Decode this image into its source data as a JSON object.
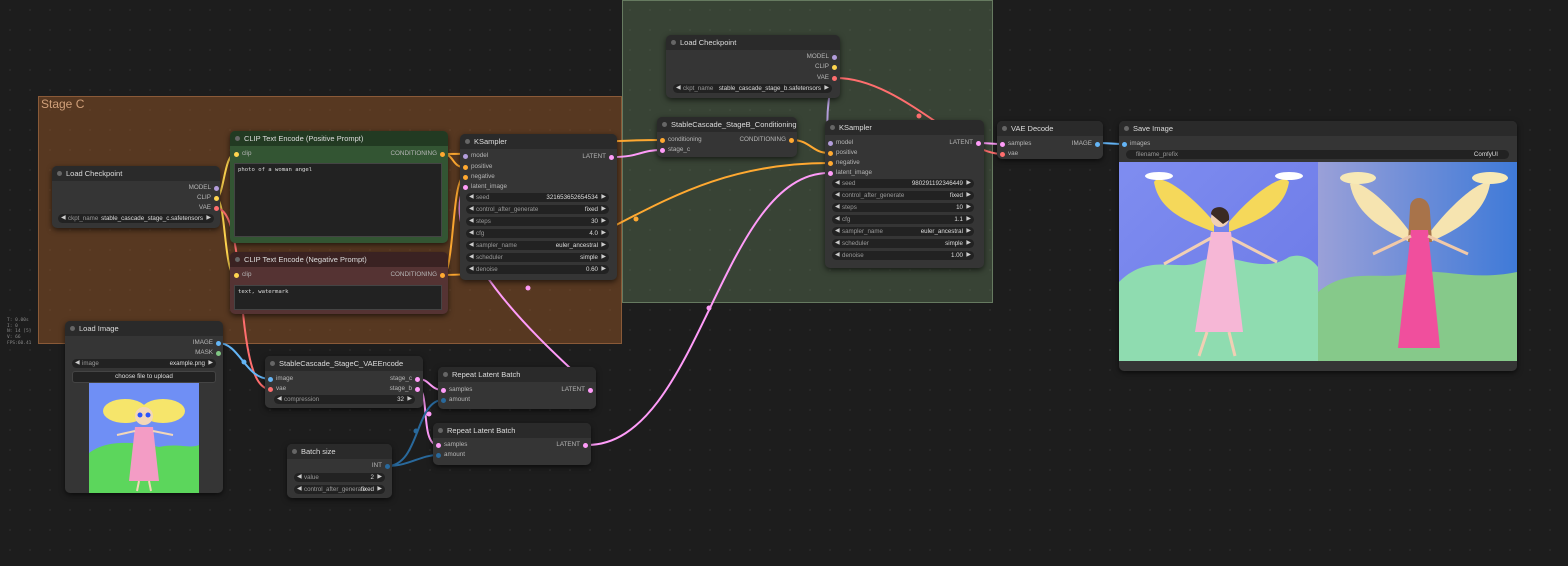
{
  "groups": {
    "stage_c": {
      "title": "Stage C"
    }
  },
  "stats": [
    "T: 0.00s",
    "I: 0",
    "N: 14 [5]",
    "V: 66",
    "FPS:60.41"
  ],
  "nodes": {
    "load_ckpt_c": {
      "title": "Load Checkpoint",
      "out_model": "MODEL",
      "out_clip": "CLIP",
      "out_vae": "VAE",
      "ckpt_label": "ckpt_name",
      "ckpt_value": "stable_cascade_stage_c.safetensors"
    },
    "clip_pos": {
      "title": "CLIP Text Encode (Positive Prompt)",
      "in_clip": "clip",
      "out": "CONDITIONING",
      "text": "photo of a woman angel"
    },
    "clip_neg": {
      "title": "CLIP Text Encode (Negative Prompt)",
      "in_clip": "clip",
      "out": "CONDITIONING",
      "text": "text, watermark"
    },
    "ksampler_c": {
      "title": "KSampler",
      "in_model": "model",
      "in_positive": "positive",
      "in_negative": "negative",
      "in_latent": "latent_image",
      "out": "LATENT",
      "w": [
        {
          "label": "seed",
          "value": "321653652654534"
        },
        {
          "label": "control_after_generate",
          "value": "fixed"
        },
        {
          "label": "steps",
          "value": "30"
        },
        {
          "label": "cfg",
          "value": "4.0"
        },
        {
          "label": "sampler_name",
          "value": "euler_ancestral"
        },
        {
          "label": "scheduler",
          "value": "simple"
        },
        {
          "label": "denoise",
          "value": "0.60"
        }
      ]
    },
    "load_image": {
      "title": "Load Image",
      "out_image": "IMAGE",
      "out_mask": "MASK",
      "image_label": "image",
      "image_value": "example.png",
      "upload": "choose file to upload"
    },
    "vae_encode": {
      "title": "StableCascade_StageC_VAEEncode",
      "in_image": "image",
      "in_vae": "vae",
      "out_c": "stage_c",
      "out_b": "stage_b",
      "comp_label": "compression",
      "comp_value": "32"
    },
    "repeat1": {
      "title": "Repeat Latent Batch",
      "in_samples": "samples",
      "in_amount": "amount",
      "out": "LATENT"
    },
    "repeat2": {
      "title": "Repeat Latent Batch",
      "in_samples": "samples",
      "in_amount": "amount",
      "out": "LATENT"
    },
    "batch": {
      "title": "Batch size",
      "out": "INT",
      "value_label": "value",
      "value_value": "2",
      "ctrl_label": "control_after_generate",
      "ctrl_value": "fixed"
    },
    "load_ckpt_b": {
      "title": "Load Checkpoint",
      "out_model": "MODEL",
      "out_clip": "CLIP",
      "out_vae": "VAE",
      "ckpt_label": "ckpt_name",
      "ckpt_value": "stable_cascade_stage_b.safetensors"
    },
    "stageb_cond": {
      "title": "StableCascade_StageB_Conditioning",
      "in_cond": "conditioning",
      "in_stagec": "stage_c",
      "out": "CONDITIONING"
    },
    "ksampler_b": {
      "title": "KSampler",
      "in_model": "model",
      "in_positive": "positive",
      "in_negative": "negative",
      "in_latent": "latent_image",
      "out": "LATENT",
      "w": [
        {
          "label": "seed",
          "value": "980291192346449"
        },
        {
          "label": "control_after_generate",
          "value": "fixed"
        },
        {
          "label": "steps",
          "value": "10"
        },
        {
          "label": "cfg",
          "value": "1.1"
        },
        {
          "label": "sampler_name",
          "value": "euler_ancestral"
        },
        {
          "label": "scheduler",
          "value": "simple"
        },
        {
          "label": "denoise",
          "value": "1.00"
        }
      ]
    },
    "vae_decode": {
      "title": "VAE Decode",
      "in_samples": "samples",
      "in_vae": "vae",
      "out": "IMAGE"
    },
    "save_image": {
      "title": "Save Image",
      "in_images": "images",
      "prefix_label": "filename_prefix",
      "prefix_value": "ComfyUI"
    }
  },
  "colors": {
    "model": "#b39ddb",
    "clip": "#ffd54f",
    "vae": "#ff6e6e",
    "conditioning": "#ffa931",
    "latent": "#ff9cf9",
    "image": "#64b5f6",
    "int": "#29699c",
    "mask": "#81c784"
  }
}
